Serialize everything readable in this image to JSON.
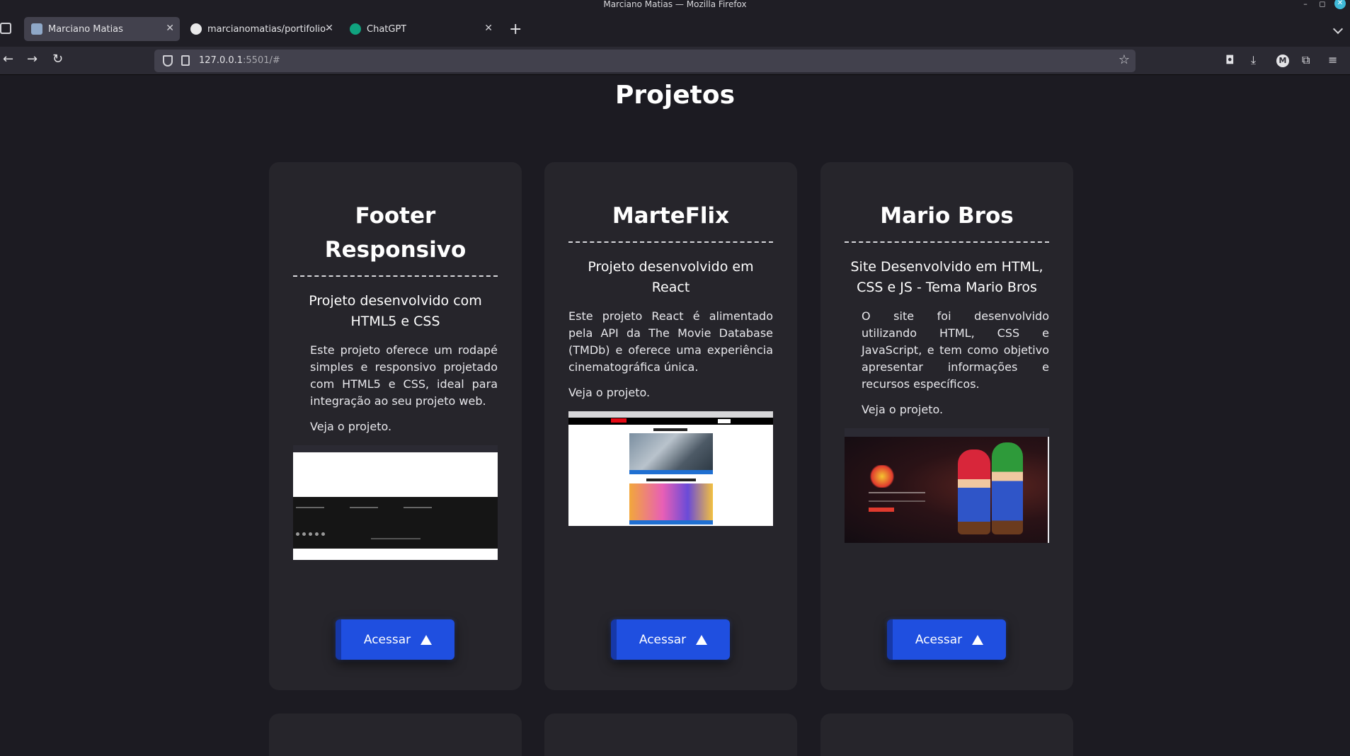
{
  "window": {
    "title": "Marciano Matias — Mozilla Firefox",
    "controls": {
      "minimize": "–",
      "maximize": "◻",
      "close": "✕"
    }
  },
  "tabs": [
    {
      "label": "Marciano Matias",
      "icon": "monitor-icon",
      "active": true,
      "close": "✕"
    },
    {
      "label": "marcianomatias/portifolio-",
      "icon": "github-icon",
      "active": false,
      "close": "✕"
    },
    {
      "label": "ChatGPT",
      "icon": "chatgpt-icon",
      "active": false,
      "close": "✕"
    }
  ],
  "toolbar": {
    "new_tab": "+",
    "back": "←",
    "forward": "→",
    "reload": "↻",
    "url_host": "127.0.0.1",
    "url_rest": ":5501/#",
    "bookmark_star": "☆",
    "pocket": "◘",
    "downloads": "⤓",
    "account": "M",
    "extensions": "⧉",
    "menu": "≡"
  },
  "page": {
    "section_title": "Projetos",
    "cards": [
      {
        "title": "Footer Responsivo",
        "subtitle": "Projeto desenvolvido com HTML5 e CSS",
        "description": "Este projeto oferece um rodapé simples e responsivo projetado com HTML5 e CSS, ideal para integração ao seu projeto web.",
        "link_text": "Veja o projeto.",
        "button_label": "Acessar"
      },
      {
        "title": "MarteFlix",
        "subtitle": "Projeto desenvolvido em React",
        "description": "Este projeto React é alimentado pela API da The Movie Database (TMDb) e oferece uma experiência cinematográfica única.",
        "link_text": "Veja o projeto.",
        "button_label": "Acessar"
      },
      {
        "title": "Mario Bros",
        "subtitle": "Site Desenvolvido em HTML, CSS e JS - Tema Mario Bros",
        "description": "O site foi desenvolvido utilizando HTML, CSS e JavaScript, e tem como objetivo apresentar informações e recursos específicos.",
        "link_text": "Veja o projeto.",
        "button_label": "Acessar"
      }
    ]
  },
  "colors": {
    "page_background": "#1c1b22",
    "card_background": "#26252b",
    "button_blue": "#1f4fe0",
    "text_white": "#ffffff"
  }
}
